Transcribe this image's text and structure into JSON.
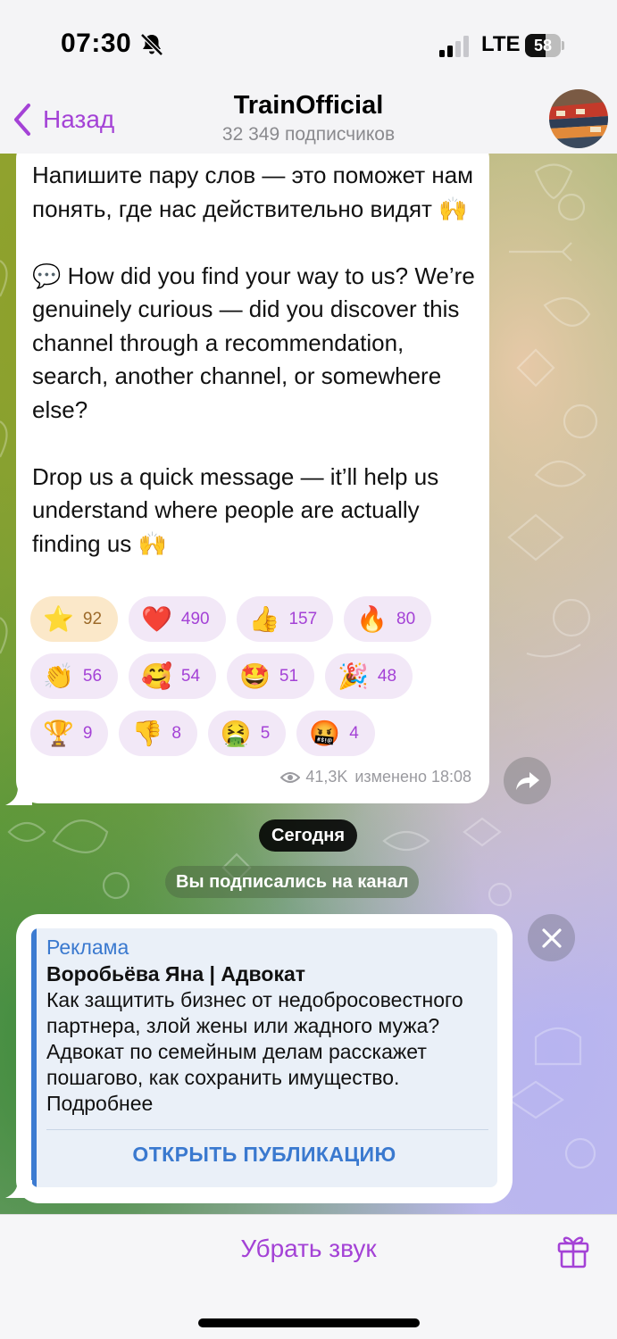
{
  "status_bar": {
    "time": "07:30",
    "network": "LTE",
    "battery_level": "58",
    "battery_fraction": 0.58
  },
  "header": {
    "back_label": "Назад",
    "title": "TrainOfficial",
    "subtitle": "32 349 подписчиков"
  },
  "message": {
    "text": "Напишите пару слов — это поможет нам понять, где нас действительно видят 🙌\n\n💬 How did you find your way to us? We’re genuinely curious — did you discover this channel through a recommendation, search, another channel, or somewhere else?\n\nDrop us a quick message — it’ll help us understand where people are actually finding us 🙌",
    "reactions": [
      {
        "emoji": "⭐",
        "count": "92"
      },
      {
        "emoji": "❤️",
        "count": "490"
      },
      {
        "emoji": "👍",
        "count": "157"
      },
      {
        "emoji": "🔥",
        "count": "80"
      },
      {
        "emoji": "👏",
        "count": "56"
      },
      {
        "emoji": "🥰",
        "count": "54"
      },
      {
        "emoji": "🤩",
        "count": "51"
      },
      {
        "emoji": "🎉",
        "count": "48"
      },
      {
        "emoji": "🏆",
        "count": "9"
      },
      {
        "emoji": "👎",
        "count": "8"
      },
      {
        "emoji": "🤮",
        "count": "5"
      },
      {
        "emoji": "🤬",
        "count": "4"
      }
    ],
    "views": "41,3K",
    "edited_time": "изменено 18:08"
  },
  "date_pill": "Сегодня",
  "service_message": "Вы подписались на канал",
  "ad": {
    "label": "Реклама",
    "title": "Воробьёва Яна | Адвокат",
    "body": "Как защитить бизнес от недобросовестного партнера, злой жены или жадного мужа? Адвокат по семейным делам расскажет пошагово, как сохранить имущество. Подробнее",
    "button": "ОТКРЫТЬ ПУБЛИКАЦИЮ"
  },
  "bottom_bar": {
    "mute_label": "Убрать звук"
  },
  "colors": {
    "accent": "#a442d6",
    "ad_accent": "#3a79cf",
    "reaction_bg": "#f2e8f7",
    "reaction_active_bg": "#fbe8c9"
  }
}
